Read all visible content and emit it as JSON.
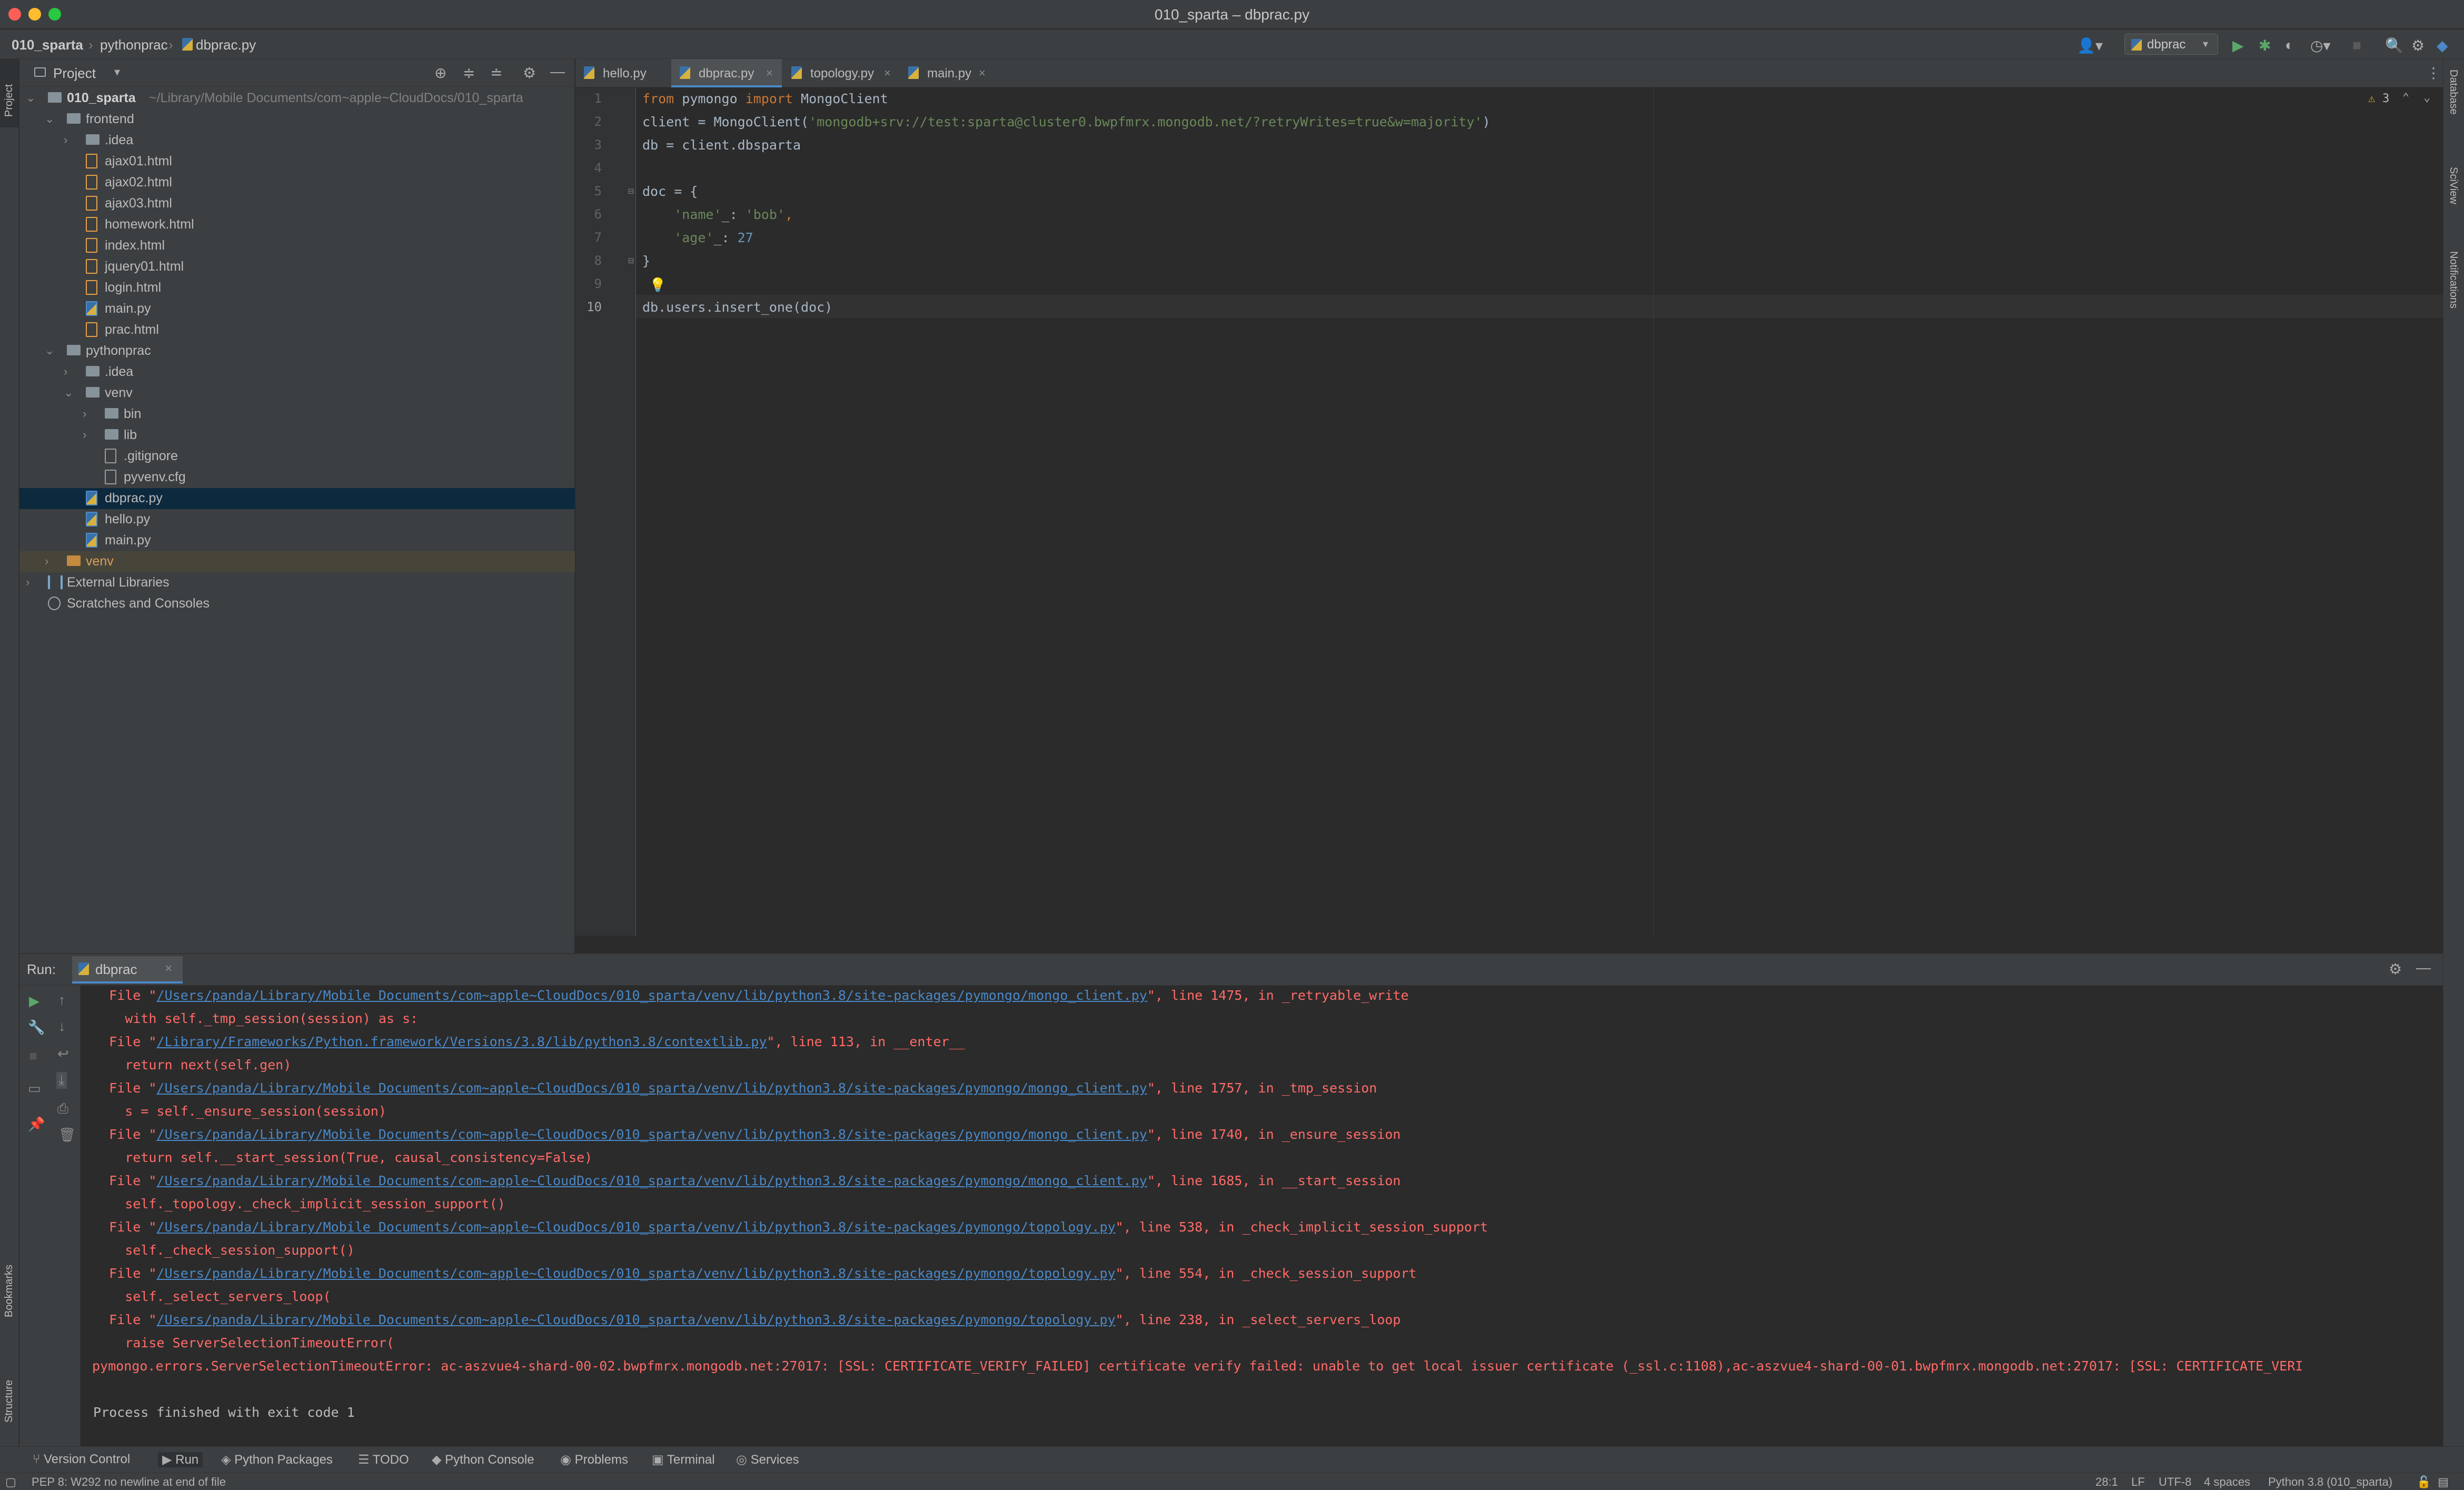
{
  "window": {
    "title": "010_sparta – dbprac.py"
  },
  "breadcrumb": [
    "010_sparta",
    "pythonprac",
    "dbprac.py"
  ],
  "run_config": "dbprac",
  "left_strip": {
    "project": "Project",
    "bookmarks": "Bookmarks",
    "structure": "Structure"
  },
  "right_strip": {
    "database": "Database",
    "sciview": "SciView",
    "notifications": "Notifications"
  },
  "project_panel": {
    "title": "Project",
    "tree": [
      {
        "label": "010_sparta",
        "path": "~/Library/Mobile Documents/com~apple~CloudDocs/010_sparta"
      },
      {
        "label": "frontend"
      },
      {
        "label": ".idea"
      },
      {
        "label": "ajax01.html"
      },
      {
        "label": "ajax02.html"
      },
      {
        "label": "ajax03.html"
      },
      {
        "label": "homework.html"
      },
      {
        "label": "index.html"
      },
      {
        "label": "jquery01.html"
      },
      {
        "label": "login.html"
      },
      {
        "label": "main.py"
      },
      {
        "label": "prac.html"
      },
      {
        "label": "pythonprac"
      },
      {
        "label": ".idea"
      },
      {
        "label": "venv"
      },
      {
        "label": "bin"
      },
      {
        "label": "lib"
      },
      {
        "label": ".gitignore"
      },
      {
        "label": "pyvenv.cfg"
      },
      {
        "label": "dbprac.py"
      },
      {
        "label": "hello.py"
      },
      {
        "label": "main.py"
      },
      {
        "label": "venv"
      },
      {
        "label": "External Libraries"
      },
      {
        "label": "Scratches and Consoles"
      }
    ]
  },
  "tabs": [
    "hello.py",
    "dbprac.py",
    "topology.py",
    "main.py"
  ],
  "editor": {
    "warnings": "3",
    "line_numbers": [
      "1",
      "2",
      "3",
      "4",
      "5",
      "6",
      "7",
      "8",
      "9",
      "10"
    ],
    "code": {
      "l1_kw1": "from",
      "l1_mod": " pymongo ",
      "l1_kw2": "import",
      "l1_cls": " MongoClient",
      "l2_pre": "client = MongoClient(",
      "l2_str": "'mongodb+srv://test:sparta@cluster0.bwpfmrx.mongodb.net/?retryWrites=true&w=majority'",
      "l2_post": ")",
      "l3": "db = client.dbsparta",
      "l5": "doc = {",
      "l6_str": "    'name'",
      "l6_sep": "_: ",
      "l6_val": "'bob'",
      "l6_end": ",",
      "l7_str": "    'age'",
      "l7_sep": "_: ",
      "l7_val": "27",
      "l8": "}",
      "l10": "db.users.insert_one(doc)"
    }
  },
  "run": {
    "label": "Run:",
    "tab": "dbprac",
    "lines": [
      {
        "pre": "  File \"",
        "link": "/Users/panda/Library/Mobile Documents/com~apple~CloudDocs/010_sparta/venv/lib/python3.8/site-packages/pymongo/mongo_client.py",
        "post": "\", line 1475, in _retryable_write"
      },
      {
        "text": "    with self._tmp_session(session) as s:"
      },
      {
        "pre": "  File \"",
        "link": "/Library/Frameworks/Python.framework/Versions/3.8/lib/python3.8/contextlib.py",
        "post": "\", line 113, in __enter__"
      },
      {
        "text": "    return next(self.gen)"
      },
      {
        "pre": "  File \"",
        "link": "/Users/panda/Library/Mobile Documents/com~apple~CloudDocs/010_sparta/venv/lib/python3.8/site-packages/pymongo/mongo_client.py",
        "post": "\", line 1757, in _tmp_session"
      },
      {
        "text": "    s = self._ensure_session(session)"
      },
      {
        "pre": "  File \"",
        "link": "/Users/panda/Library/Mobile Documents/com~apple~CloudDocs/010_sparta/venv/lib/python3.8/site-packages/pymongo/mongo_client.py",
        "post": "\", line 1740, in _ensure_session"
      },
      {
        "text": "    return self.__start_session(True, causal_consistency=False)"
      },
      {
        "pre": "  File \"",
        "link": "/Users/panda/Library/Mobile Documents/com~apple~CloudDocs/010_sparta/venv/lib/python3.8/site-packages/pymongo/mongo_client.py",
        "post": "\", line 1685, in __start_session"
      },
      {
        "text": "    self._topology._check_implicit_session_support()"
      },
      {
        "pre": "  File \"",
        "link": "/Users/panda/Library/Mobile Documents/com~apple~CloudDocs/010_sparta/venv/lib/python3.8/site-packages/pymongo/topology.py",
        "post": "\", line 538, in _check_implicit_session_support"
      },
      {
        "text": "    self._check_session_support()"
      },
      {
        "pre": "  File \"",
        "link": "/Users/panda/Library/Mobile Documents/com~apple~CloudDocs/010_sparta/venv/lib/python3.8/site-packages/pymongo/topology.py",
        "post": "\", line 554, in _check_session_support"
      },
      {
        "text": "    self._select_servers_loop("
      },
      {
        "pre": "  File \"",
        "link": "/Users/panda/Library/Mobile Documents/com~apple~CloudDocs/010_sparta/venv/lib/python3.8/site-packages/pymongo/topology.py",
        "post": "\", line 238, in _select_servers_loop"
      },
      {
        "text": "    raise ServerSelectionTimeoutError("
      },
      {
        "text": "pymongo.errors.ServerSelectionTimeoutError: ac-aszvue4-shard-00-02.bwpfmrx.mongodb.net:27017: [SSL: CERTIFICATE_VERIFY_FAILED] certificate verify failed: unable to get local issuer certificate (_ssl.c:1108),ac-aszvue4-shard-00-01.bwpfmrx.mongodb.net:27017: [SSL: CERTIFICATE_VERI"
      },
      {
        "text": ""
      },
      {
        "text": "Process finished with exit code 1",
        "normal": true
      }
    ]
  },
  "toolwindows": [
    "Version Control",
    "Run",
    "Python Packages",
    "TODO",
    "Python Console",
    "Problems",
    "Terminal",
    "Services"
  ],
  "status": {
    "message": "PEP 8: W292 no newline at end of file",
    "position": "28:1",
    "line_sep": "LF",
    "encoding": "UTF-8",
    "indent": "4 spaces",
    "interpreter": "Python 3.8 (010_sparta)"
  },
  "colors": {
    "accent": "#4a88c7",
    "error": "#ff6b68",
    "link": "#4a88c7",
    "selection": "#0d293e"
  }
}
